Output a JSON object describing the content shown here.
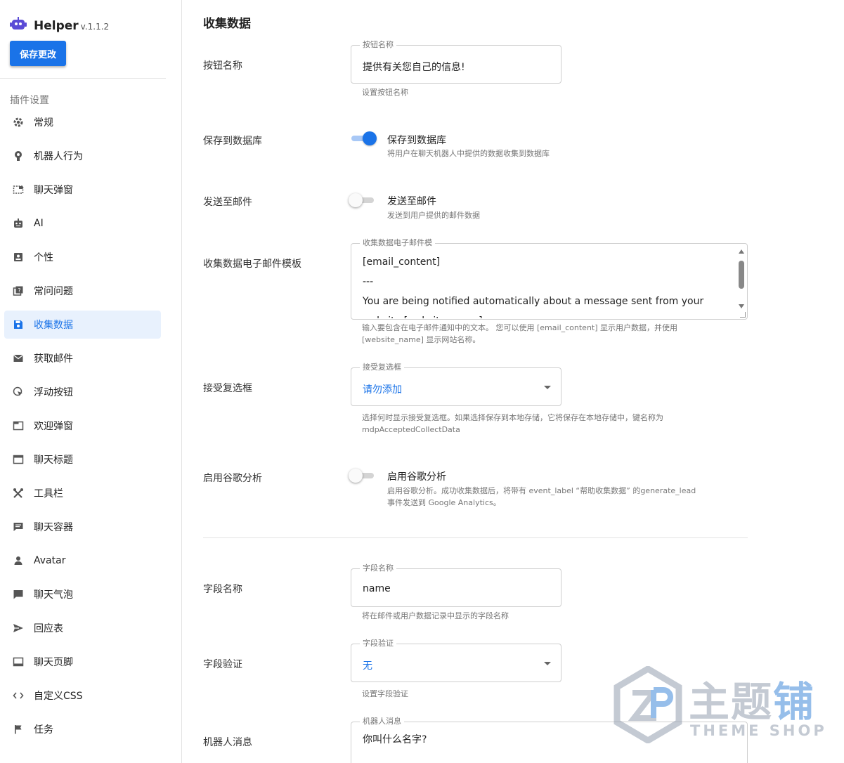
{
  "app": {
    "name": "Helper",
    "version": "v.1.1.2"
  },
  "toolbar": {
    "save_label": "保存更改"
  },
  "sidebar": {
    "section_label": "插件设置",
    "items": [
      {
        "label": "常规",
        "icon": "gear-icon"
      },
      {
        "label": "机器人行为",
        "icon": "brain-icon"
      },
      {
        "label": "聊天弹窗",
        "icon": "popup-icon"
      },
      {
        "label": "AI",
        "icon": "robot-icon"
      },
      {
        "label": "个性",
        "icon": "person-card-icon"
      },
      {
        "label": "常问问题",
        "icon": "faq-icon"
      },
      {
        "label": "收集数据",
        "icon": "save-icon",
        "active": true
      },
      {
        "label": "获取邮件",
        "icon": "mail-icon"
      },
      {
        "label": "浮动按钮",
        "icon": "cursor-icon"
      },
      {
        "label": "欢迎弹窗",
        "icon": "window-icon"
      },
      {
        "label": "聊天标题",
        "icon": "header-icon"
      },
      {
        "label": "工具栏",
        "icon": "tools-icon"
      },
      {
        "label": "聊天容器",
        "icon": "chat-box-icon"
      },
      {
        "label": "Avatar",
        "icon": "user-icon"
      },
      {
        "label": "聊天气泡",
        "icon": "bubble-icon"
      },
      {
        "label": "回应表",
        "icon": "send-icon"
      },
      {
        "label": "聊天页脚",
        "icon": "footer-icon"
      },
      {
        "label": "自定义CSS",
        "icon": "code-icon"
      },
      {
        "label": "任务",
        "icon": "flag-icon"
      }
    ]
  },
  "main": {
    "title": "收集数据",
    "button_name": {
      "label": "按钮名称",
      "legend": "按钮名称",
      "value": "提供有关您自己的信息!",
      "helper": "设置按钮名称"
    },
    "save_to_db": {
      "label": "保存到数据库",
      "on": true,
      "title": "保存到数据库",
      "desc": "将用户在聊天机器人中提供的数据收集到数据库"
    },
    "send_email": {
      "label": "发送至邮件",
      "on": false,
      "title": "发送至邮件",
      "desc": "发送到用户提供的邮件数据"
    },
    "email_template": {
      "label": "收集数据电子邮件模板",
      "legend": "收集数据电子邮件模",
      "value": "[email_content]\n---\nYou are being notified automatically about a message sent from your\nwebsite [website_name]",
      "helper_1": "输入要包含在电子邮件通知中的文本。 您可以使用 [email_content] 显示用户数据，并使用",
      "helper_2": "[website_name] 显示网站名称。"
    },
    "accept_checkbox": {
      "label": "接受复选框",
      "legend": "接受复选框",
      "value": "请勿添加",
      "helper_1": "选择何时显示接受复选框。如果选择保存到本地存储，它将保存在本地存储中，键名称为",
      "helper_2": "mdpAcceptedCollectData"
    },
    "google_analytics": {
      "label": "启用谷歌分析",
      "on": false,
      "title": "启用谷歌分析",
      "desc_1": "启用谷歌分析。成功收集数据后，将带有 event_label “帮助收集数据” 的generate_lead",
      "desc_2": "事件发送到 Google Analytics。"
    },
    "field_name": {
      "label": "字段名称",
      "legend": "字段名称",
      "value": "name",
      "helper": "将在邮件或用户数据记录中显示的字段名称"
    },
    "field_validation": {
      "label": "字段验证",
      "legend": "字段验证",
      "value": "无",
      "helper": "设置字段验证"
    },
    "bot_message": {
      "label": "机器人消息",
      "legend": "机器人消息",
      "value": "你叫什么名字?"
    }
  },
  "watermark": {
    "text_main": "主题",
    "text_accent": "铺",
    "text_sub": "THEME SHOP"
  },
  "colors": {
    "accent": "#1a73e8",
    "active_bg": "#e8f1fd"
  }
}
